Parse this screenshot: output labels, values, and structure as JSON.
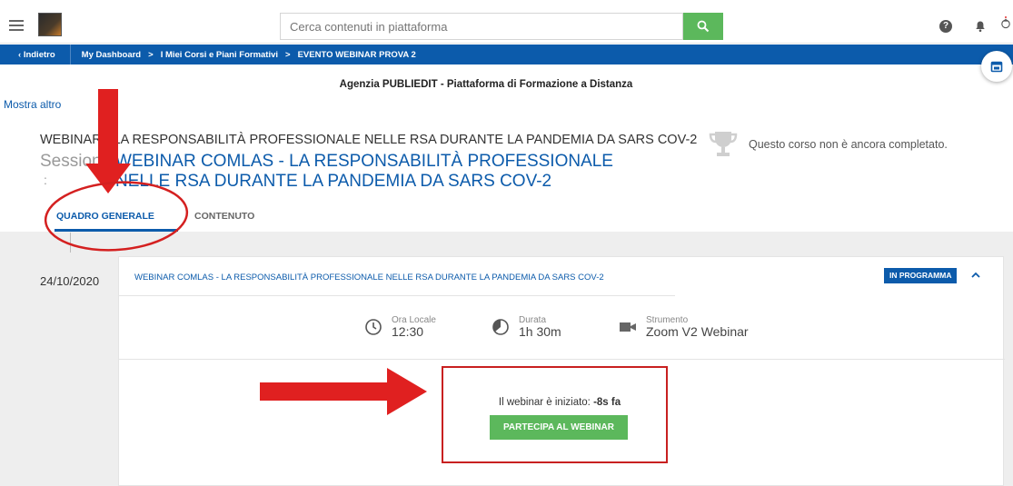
{
  "topbar": {
    "search_placeholder": "Cerca contenuti in piattaforma",
    "help_glyph": "?"
  },
  "breadcrumb": {
    "back": "Indietro",
    "items": [
      "My Dashboard",
      "I Miei Corsi e Piani Formativi",
      "EVENTO WEBINAR PROVA 2"
    ],
    "separator": ">"
  },
  "header": {
    "organization": "Agenzia PUBLIEDIT -  Piattaforma di Formazione a Distanza",
    "show_more": "Mostra altro"
  },
  "course": {
    "title": "WEBINAR - LA RESPONSABILITÀ PROFESSIONALE NELLE RSA DURANTE LA PANDEMIA DA SARS COV-2",
    "session_label": "Sessione",
    "session_colon": ":",
    "session_title": "WEBINAR COMLAS - LA RESPONSABILITÀ PROFESSIONALE NELLE RSA DURANTE LA PANDEMIA DA SARS COV-2",
    "completion_status": "Questo corso non è ancora completato."
  },
  "tabs": [
    {
      "label": "QUADRO GENERALE",
      "active": true
    },
    {
      "label": "CONTENUTO",
      "active": false
    }
  ],
  "session_card": {
    "date": "24/10/2020",
    "title": "WEBINAR COMLAS - LA RESPONSABILITÀ PROFESSIONALE NELLE RSA DURANTE LA PANDEMIA DA SARS COV-2",
    "status": "IN PROGRAMMA",
    "details": [
      {
        "label": "Ora Locale",
        "value": "12:30",
        "icon": "clock-icon"
      },
      {
        "label": "Durata",
        "value": "1h 30m",
        "icon": "duration-icon"
      },
      {
        "label": "Strumento",
        "value": "Zoom V2 Webinar",
        "icon": "video-camera-icon"
      }
    ],
    "started_text": "Il webinar è iniziato: ",
    "started_value": "-8s fa",
    "join_button": "PARTECIPA AL WEBINAR"
  },
  "colors": {
    "primary": "#0c5bab",
    "success": "#5cb85c",
    "annotation": "#e02020"
  }
}
